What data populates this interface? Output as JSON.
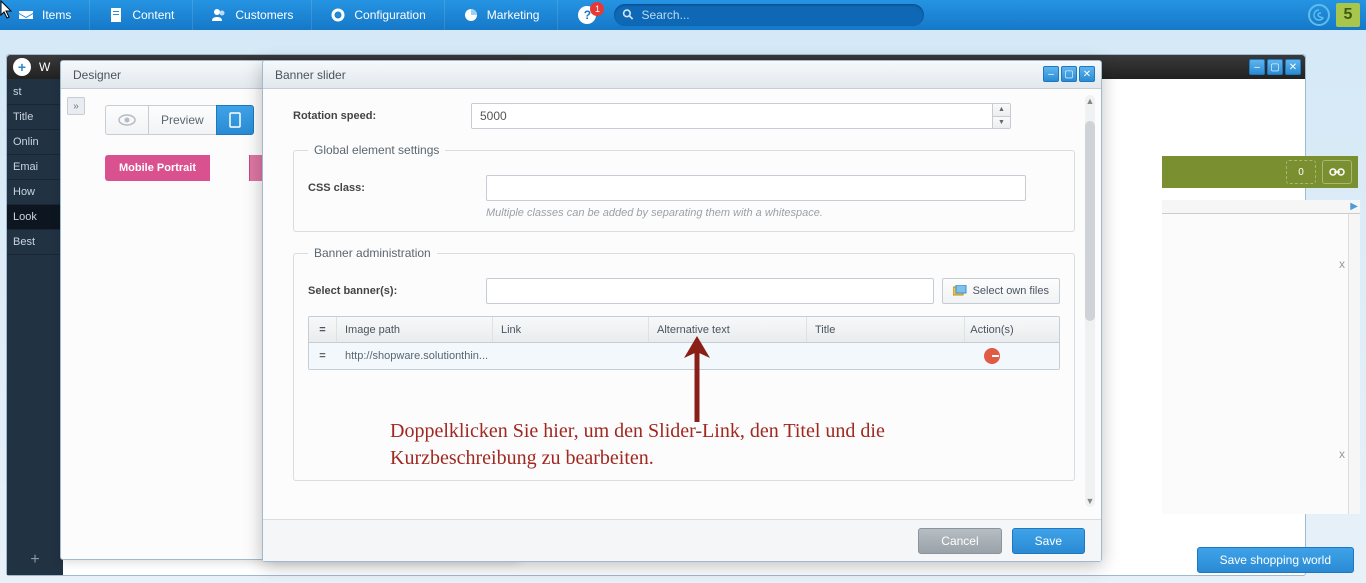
{
  "topbar": {
    "items": [
      "Items",
      "Content",
      "Customers",
      "Configuration",
      "Marketing"
    ],
    "help_badge": "1",
    "search_placeholder": "Search..."
  },
  "bg_window": {
    "title_letter": "W",
    "sidebar_header": "st",
    "sidebar_items": [
      "Title",
      "Onlin",
      "Emai",
      "How",
      "Look",
      "Best"
    ],
    "selected_index": 4,
    "olive_badge": "0"
  },
  "save_shopping_world": "Save shopping world",
  "designer": {
    "title": "Designer",
    "preview": "Preview",
    "pink_tab": "Mobile Portrait"
  },
  "modal": {
    "title": "Banner slider",
    "rotation_label": "Rotation speed:",
    "rotation_value": "5000",
    "global_legend": "Global element settings",
    "css_label": "CSS class:",
    "css_hint": "Multiple classes can be added by separating them with a whitespace.",
    "banner_legend": "Banner administration",
    "select_label": "Select banner(s):",
    "select_btn": "Select own files",
    "columns": {
      "handle": "=",
      "img": "Image path",
      "link": "Link",
      "alt": "Alternative text",
      "title": "Title",
      "act": "Action(s)"
    },
    "row": {
      "handle": "=",
      "img": "http://shopware.solutionthin...",
      "link": "",
      "alt": "",
      "title": ""
    },
    "cancel": "Cancel",
    "save": "Save"
  },
  "annotation": "Doppelklicken Sie hier, um den Slider-Link, den Titel und die Kurzbeschreibung zu bearbeiten."
}
